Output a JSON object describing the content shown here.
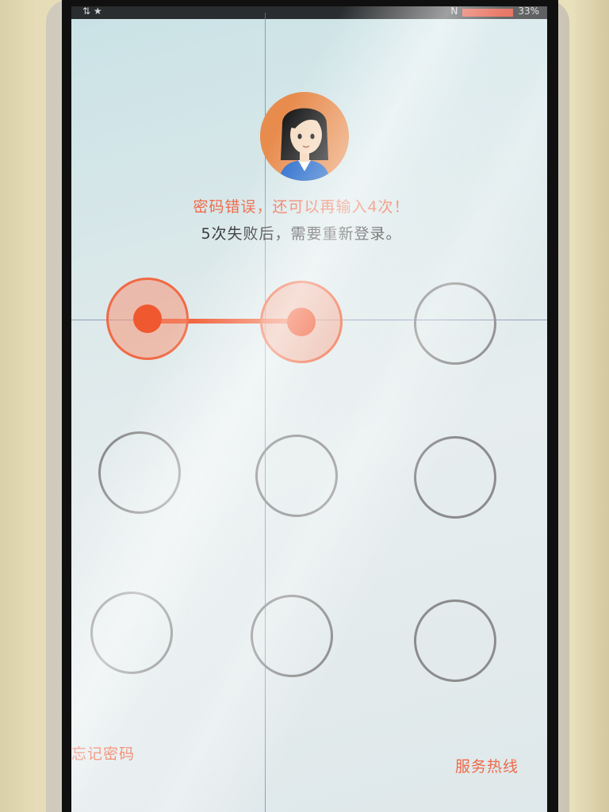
{
  "status_bar": {
    "battery_text": "33%"
  },
  "messages": {
    "error": "密码错误，还可以再输入4次！",
    "info": "5次失败后，需要重新登录。"
  },
  "pattern": {
    "selected_dots": [
      1,
      2
    ]
  },
  "links": {
    "forgot_password": "忘记密码",
    "service_hotline": "服务热线"
  },
  "colors": {
    "accent": "#f0582f",
    "error_text": "#ee6a4a",
    "dot_border": "#8c8c8c"
  },
  "icons": {
    "avatar": "user-avatar-icon"
  }
}
